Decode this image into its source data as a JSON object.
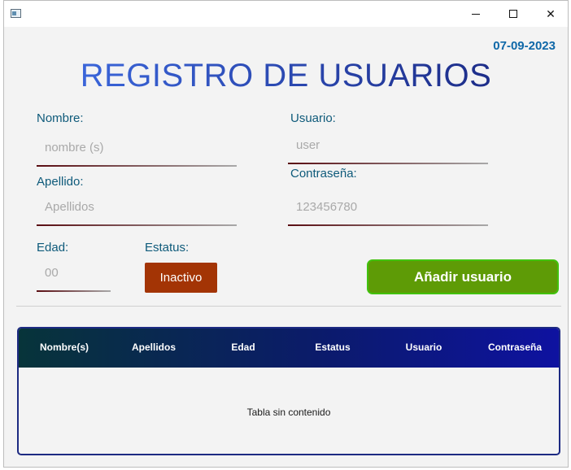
{
  "window": {
    "controls": {
      "minimize_icon": "minimize-icon",
      "maximize_icon": "maximize-icon",
      "close_icon": "close-icon",
      "close_glyph": "✕"
    }
  },
  "header": {
    "date": "07-09-2023",
    "title": "REGISTRO DE USUARIOS"
  },
  "form": {
    "nombre": {
      "label": "Nombre:",
      "placeholder": "nombre (s)"
    },
    "apellido": {
      "label": "Apellido:",
      "placeholder": "Apellidos"
    },
    "edad": {
      "label": "Edad:",
      "placeholder": "00"
    },
    "estatus": {
      "label": "Estatus:",
      "button": "Inactivo"
    },
    "usuario": {
      "label": "Usuario:",
      "placeholder": "user"
    },
    "contrasena": {
      "label": "Contraseña:",
      "placeholder": "123456780"
    }
  },
  "actions": {
    "add_user": "Añadir usuario"
  },
  "table": {
    "columns": [
      "Nombre(s)",
      "Apellidos",
      "Edad",
      "Estatus",
      "Usuario",
      "Contraseña"
    ],
    "empty_text": "Tabla sin contenido"
  },
  "colors": {
    "accent_title_start": "#3f6fe8",
    "accent_title_end": "#18237a",
    "status_button": "#a33405",
    "add_button": "#5e9b06",
    "date": "#0f68a8"
  }
}
